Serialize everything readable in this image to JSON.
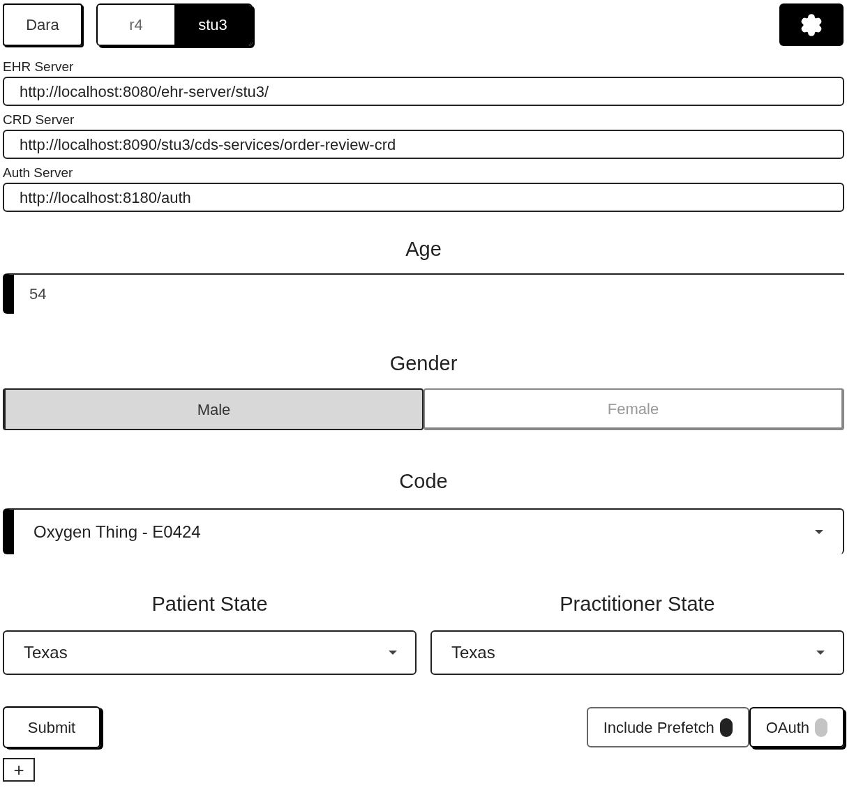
{
  "user_button": "Dara",
  "versions": [
    {
      "label": "r4",
      "selected": false
    },
    {
      "label": "stu3",
      "selected": true
    }
  ],
  "servers": [
    {
      "label": "EHR Server",
      "value": "http://localhost:8080/ehr-server/stu3/"
    },
    {
      "label": "CRD Server",
      "value": "http://localhost:8090/stu3/cds-services/order-review-crd"
    },
    {
      "label": "Auth Server",
      "value": "http://localhost:8180/auth"
    }
  ],
  "age": {
    "heading": "Age",
    "value": "54"
  },
  "gender": {
    "heading": "Gender",
    "options": [
      {
        "label": "Male",
        "selected": true
      },
      {
        "label": "Female",
        "selected": false
      }
    ]
  },
  "code": {
    "heading": "Code",
    "value": "Oxygen Thing - E0424"
  },
  "states": [
    {
      "heading": "Patient State",
      "value": "Texas"
    },
    {
      "heading": "Practitioner State",
      "value": "Texas"
    }
  ],
  "submit": "Submit",
  "toggles": [
    {
      "label": "Include Prefetch",
      "on": true
    },
    {
      "label": "OAuth",
      "on": false
    }
  ],
  "add_button": "+"
}
